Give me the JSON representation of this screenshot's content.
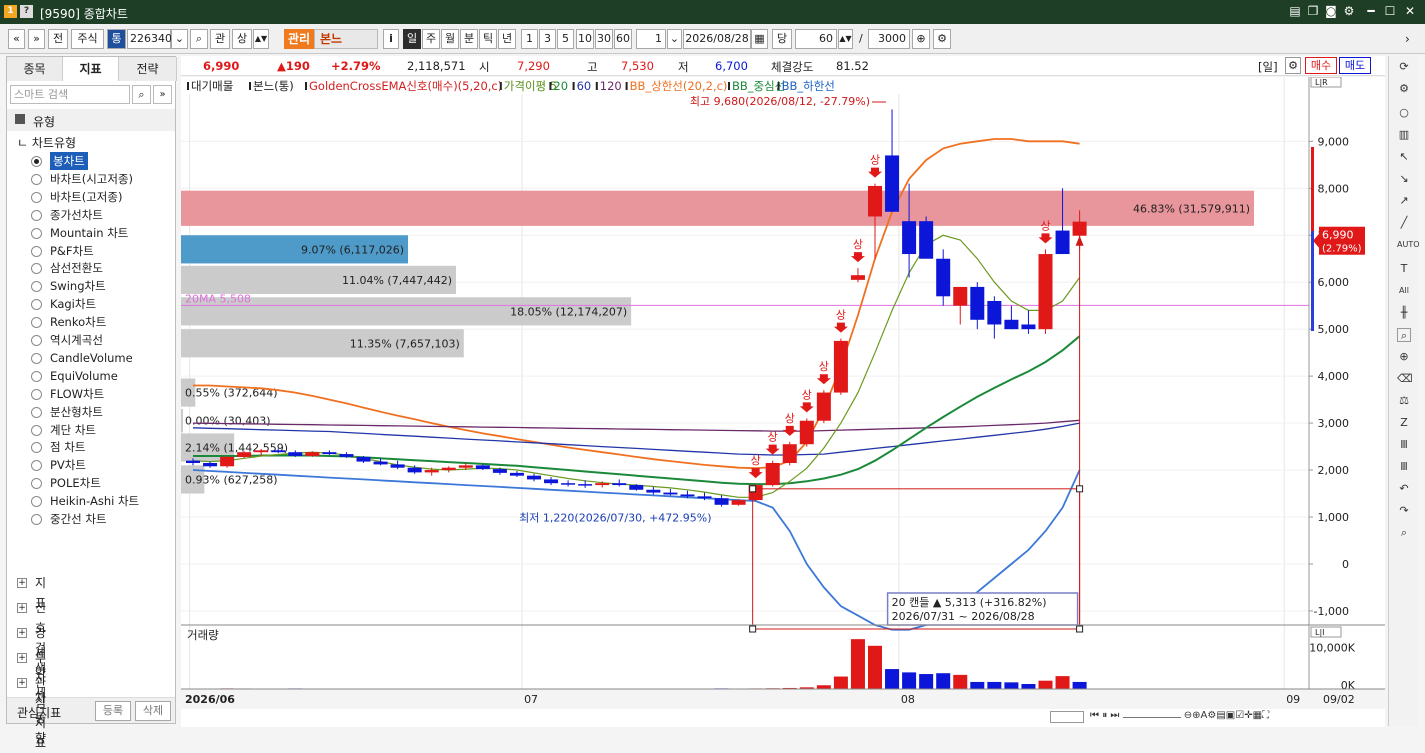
{
  "window": {
    "title": "[9590] 종합차트"
  },
  "toolbar": {
    "btn_prev": "«",
    "btn_down": "»",
    "btn_jeon": "전",
    "market": "주식",
    "market_badge": "통",
    "code": "226340",
    "btn_gwan": "관",
    "btn_sang": "상",
    "gwanli_label": "관리",
    "stock_name": "본느",
    "info": "i",
    "periods": [
      "일",
      "주",
      "월",
      "분",
      "틱",
      "년"
    ],
    "selected_period": "일",
    "intervals": [
      "1",
      "3",
      "5",
      "10",
      "30",
      "60"
    ],
    "count_value": "1",
    "date": "2026/08/28",
    "dang": "당",
    "display_count": "60",
    "slash": "/",
    "total_count": "3000"
  },
  "left_panel": {
    "tabs": [
      "종목",
      "지표",
      "전략"
    ],
    "selected_tab": "지표",
    "search_placeholder": "스마트 검색",
    "group_title": "유형",
    "subgroup_title": "차트유형",
    "chart_types": [
      "봉차트",
      "바차트(시고저종)",
      "바차트(고저종)",
      "종가선차트",
      "Mountain 차트",
      "P&F차트",
      "삼선전환도",
      "Swing차트",
      "Kagi차트",
      "Renko차트",
      "역시계곡선",
      "CandleVolume",
      "EquiVolume",
      "FLOW차트",
      "분산형차트",
      "계단 차트",
      "점 차트",
      "PV차트",
      "POLE차트",
      "Heikin-Ashi 차트",
      "중간선 차트"
    ],
    "selected_chart_type": "봉차트",
    "sections": [
      "지표",
      "신호검색",
      "강세약세",
      "투자자동향",
      "관심지표"
    ],
    "bottom_label": "관심지표",
    "btn_register": "등록",
    "btn_delete": "삭제"
  },
  "quote": {
    "price": "6,990",
    "change": "▲190",
    "change_pct": "+2.79%",
    "volume": "2,118,571",
    "open_label": "시",
    "open": "7,290",
    "high_label": "고",
    "high": "7,530",
    "low_label": "저",
    "low": "6,700",
    "strength_label": "체결강도",
    "strength": "81.52",
    "period_tag": "[일]",
    "buy_btn": "매수",
    "sell_btn": "매도"
  },
  "chart_data": {
    "type": "candlestick",
    "legend": [
      {
        "text": "대기매물",
        "color": "#222222"
      },
      {
        "text": "본느(통)",
        "color": "#222222"
      },
      {
        "text": "GoldenCrossEMA신호(매수)(5,20,c)",
        "color": "#d21f1f"
      },
      {
        "text": "가격이평 5",
        "color": "#5b8f1f"
      },
      {
        "text": "20",
        "color": "#1a8a3a"
      },
      {
        "text": "60",
        "color": "#2236a8"
      },
      {
        "text": "120",
        "color": "#6a2a6a"
      },
      {
        "text": "BB_상한선(20,2,c)",
        "color": "#f07020"
      },
      {
        "text": "BB_중심선",
        "color": "#1a8a3a"
      },
      {
        "text": "BB_하한선",
        "color": "#1c62c8"
      }
    ],
    "y_ticks": [
      "9,000",
      "8,000",
      "7,000",
      "6,000",
      "5,000",
      "4,000",
      "3,000",
      "2,000",
      "1,000",
      "0",
      "-1,000"
    ],
    "y_tick_values": [
      9000,
      8000,
      7000,
      6000,
      5000,
      4000,
      3000,
      2000,
      1000,
      0,
      -1000
    ],
    "ylim": [
      -1300,
      10200
    ],
    "x_labels": [
      "2026/06",
      "07",
      "08",
      "09",
      "09/02"
    ],
    "candles": [
      [
        2200,
        2250,
        2100,
        2150
      ],
      [
        2150,
        2180,
        2050,
        2080
      ],
      [
        2080,
        2300,
        2050,
        2280
      ],
      [
        2280,
        2400,
        2250,
        2380
      ],
      [
        2380,
        2450,
        2300,
        2420
      ],
      [
        2420,
        2460,
        2360,
        2380
      ],
      [
        2380,
        2420,
        2280,
        2300
      ],
      [
        2300,
        2400,
        2280,
        2380
      ],
      [
        2380,
        2420,
        2320,
        2340
      ],
      [
        2340,
        2380,
        2260,
        2280
      ],
      [
        2280,
        2300,
        2150,
        2180
      ],
      [
        2180,
        2250,
        2100,
        2120
      ],
      [
        2120,
        2200,
        2020,
        2050
      ],
      [
        2050,
        2100,
        1920,
        1950
      ],
      [
        1950,
        2050,
        1880,
        2000
      ],
      [
        2000,
        2080,
        1950,
        2050
      ],
      [
        2050,
        2150,
        2000,
        2100
      ],
      [
        2100,
        2120,
        2000,
        2020
      ],
      [
        2020,
        2050,
        1900,
        1940
      ],
      [
        1940,
        1980,
        1850,
        1880
      ],
      [
        1880,
        1920,
        1760,
        1800
      ],
      [
        1800,
        1850,
        1680,
        1720
      ],
      [
        1720,
        1780,
        1650,
        1700
      ],
      [
        1700,
        1780,
        1620,
        1680
      ],
      [
        1680,
        1760,
        1630,
        1720
      ],
      [
        1720,
        1800,
        1650,
        1680
      ],
      [
        1680,
        1700,
        1560,
        1580
      ],
      [
        1580,
        1640,
        1480,
        1520
      ],
      [
        1520,
        1600,
        1460,
        1480
      ],
      [
        1480,
        1560,
        1400,
        1440
      ],
      [
        1440,
        1520,
        1360,
        1400
      ],
      [
        1400,
        1460,
        1220,
        1260
      ],
      [
        1260,
        1380,
        1240,
        1360
      ],
      [
        1360,
        1700,
        1340,
        1680
      ],
      [
        1680,
        2200,
        1650,
        2150
      ],
      [
        2150,
        2600,
        2100,
        2550
      ],
      [
        2550,
        3100,
        2500,
        3050
      ],
      [
        3050,
        3700,
        3000,
        3650
      ],
      [
        3650,
        4800,
        3600,
        4750
      ],
      [
        6050,
        6300,
        6000,
        6150
      ],
      [
        7400,
        8100,
        6500,
        8050
      ],
      [
        8700,
        9680,
        7500,
        7500
      ],
      [
        7300,
        8100,
        6100,
        6600
      ],
      [
        7300,
        7400,
        6800,
        6500
      ],
      [
        6500,
        6700,
        5500,
        5700
      ],
      [
        5500,
        5800,
        5100,
        5900
      ],
      [
        5900,
        6000,
        5000,
        5200
      ],
      [
        5600,
        5700,
        4800,
        5100
      ],
      [
        5200,
        5500,
        5000,
        5000
      ],
      [
        5100,
        5400,
        4900,
        5000
      ],
      [
        5000,
        6700,
        4900,
        6600
      ],
      [
        7100,
        8000,
        6600,
        6600
      ],
      [
        6990,
        7530,
        6700,
        7290
      ]
    ],
    "candle_count": 53,
    "ma5_values": [
      2200,
      2180,
      2200,
      2250,
      2300,
      2330,
      2360,
      2380,
      2360,
      2320,
      2250,
      2180,
      2110,
      2060,
      2020,
      2000,
      2020,
      2040,
      2030,
      2000,
      1940,
      1880,
      1820,
      1770,
      1730,
      1700,
      1680,
      1650,
      1620,
      1580,
      1530,
      1470,
      1420,
      1420,
      1520,
      1760,
      2040,
      2470,
      3000,
      3650,
      4500,
      5400,
      6200,
      6800,
      7000,
      6900,
      6500,
      6000,
      5600,
      5400,
      5400,
      5600,
      6100
    ],
    "ma20_values": [
      2300,
      2300,
      2300,
      2300,
      2310,
      2310,
      2310,
      2310,
      2300,
      2290,
      2270,
      2250,
      2230,
      2210,
      2190,
      2170,
      2150,
      2130,
      2110,
      2090,
      2060,
      2030,
      2000,
      1970,
      1940,
      1910,
      1880,
      1850,
      1820,
      1790,
      1760,
      1730,
      1710,
      1700,
      1700,
      1720,
      1760,
      1820,
      1900,
      2020,
      2200,
      2420,
      2660,
      2900,
      3130,
      3350,
      3560,
      3750,
      3930,
      4100,
      4300,
      4550,
      4850
    ],
    "ma60_values": [
      2900,
      2890,
      2880,
      2870,
      2860,
      2850,
      2840,
      2830,
      2820,
      2800,
      2780,
      2760,
      2740,
      2720,
      2700,
      2680,
      2660,
      2640,
      2620,
      2600,
      2580,
      2560,
      2540,
      2520,
      2500,
      2480,
      2460,
      2440,
      2420,
      2400,
      2380,
      2360,
      2340,
      2330,
      2320,
      2320,
      2330,
      2340,
      2380,
      2420,
      2460,
      2500,
      2540,
      2580,
      2620,
      2660,
      2700,
      2740,
      2780,
      2820,
      2870,
      2930,
      3000
    ],
    "ma120_values": [
      3000,
      2995,
      2990,
      2985,
      2980,
      2975,
      2970,
      2965,
      2960,
      2955,
      2950,
      2945,
      2940,
      2935,
      2930,
      2925,
      2920,
      2915,
      2910,
      2905,
      2900,
      2895,
      2890,
      2885,
      2880,
      2875,
      2870,
      2865,
      2860,
      2855,
      2850,
      2845,
      2840,
      2835,
      2830,
      2830,
      2830,
      2840,
      2850,
      2860,
      2870,
      2880,
      2890,
      2900,
      2910,
      2920,
      2935,
      2950,
      2965,
      2980,
      3000,
      3030,
      3060
    ],
    "bb_upper_values": [
      3800,
      3800,
      3780,
      3760,
      3740,
      3700,
      3650,
      3580,
      3500,
      3420,
      3330,
      3240,
      3160,
      3080,
      3000,
      2920,
      2850,
      2780,
      2720,
      2660,
      2600,
      2540,
      2480,
      2430,
      2380,
      2330,
      2280,
      2230,
      2190,
      2150,
      2110,
      2080,
      2050,
      2040,
      2060,
      2200,
      2600,
      3300,
      4200,
      5300,
      6500,
      7500,
      8200,
      8600,
      8850,
      8950,
      9000,
      9050,
      9050,
      9000,
      9000,
      9000,
      8950
    ],
    "bb_lower_values": [
      2000,
      1980,
      1960,
      1940,
      1920,
      1900,
      1880,
      1860,
      1840,
      1820,
      1800,
      1780,
      1760,
      1740,
      1720,
      1700,
      1680,
      1660,
      1640,
      1620,
      1600,
      1580,
      1560,
      1540,
      1520,
      1500,
      1480,
      1460,
      1440,
      1420,
      1400,
      1380,
      1360,
      1340,
      1200,
      700,
      0,
      -500,
      -900,
      -1100,
      -1300,
      -1400,
      -1400,
      -1300,
      -1200,
      -900,
      -600,
      -300,
      0,
      300,
      700,
      1200,
      2000
    ],
    "buy_signals": [
      33,
      34,
      35,
      36,
      37,
      38,
      39,
      40,
      50
    ],
    "buy_signal_label": "상",
    "supply_zones": [
      {
        "label": "46.83% (31,579,911)",
        "from": 7200,
        "to": 7950,
        "pct": 0.9,
        "highlight": true
      },
      {
        "label": "9.07% (6,117,026)",
        "from": 6400,
        "to": 7000,
        "pct": 0.175
      },
      {
        "label": "11.04% (7,447,442)",
        "from": 5750,
        "to": 6350,
        "pct": 0.212
      },
      {
        "label": "18.05% (12,174,207)",
        "from": 5080,
        "to": 5680,
        "pct": 0.347
      },
      {
        "label": "11.35% (7,657,103)",
        "from": 4400,
        "to": 5000,
        "pct": 0.218
      },
      {
        "label": "0.55% (372,644)",
        "from": 3350,
        "to": 3950,
        "pct": 0.011
      },
      {
        "label": "0.00% (30,403)",
        "from": 2800,
        "to": 3300,
        "pct": 0.001
      },
      {
        "label": "2.14% (1,442,559)",
        "from": 2180,
        "to": 2780,
        "pct": 0.041
      },
      {
        "label": "0.93% (627,258)",
        "from": 1500,
        "to": 2100,
        "pct": 0.018
      }
    ],
    "ma20_line_label": "20MA 5,508",
    "ma20_line_value": 5508,
    "high_annotation": "최고 9,680(2026/08/12, -27.79%)",
    "low_annotation": "최저 1,220(2026/07/30, +472.95%)",
    "price_tag": "6,990",
    "price_tag_pct": "(2.79%)",
    "range_box": {
      "line1": "20 캔들  ▲ 5,313 (+316.82%)",
      "line2": "2026/07/31 ~ 2026/08/28",
      "from_index": 33,
      "to_index": 52
    },
    "volume_title": "거래량",
    "volume_ticks": [
      "10,000K",
      "0K"
    ],
    "volume_values": [
      120,
      100,
      150,
      130,
      110,
      100,
      140,
      120,
      100,
      110,
      90,
      100,
      120,
      110,
      90,
      80,
      100,
      110,
      120,
      90,
      100,
      80,
      110,
      90,
      100,
      80,
      90,
      70,
      80,
      60,
      80,
      150,
      100,
      140,
      180,
      250,
      400,
      900,
      3000,
      12000,
      10400,
      4800,
      4000,
      3600,
      3800,
      3400,
      1700,
      1700,
      1600,
      1200,
      2000,
      3100,
      1700
    ],
    "volume_up": [
      0,
      0,
      1,
      1,
      1,
      0,
      0,
      1,
      0,
      0,
      0,
      0,
      0,
      0,
      1,
      1,
      1,
      0,
      0,
      0,
      0,
      0,
      0,
      0,
      1,
      0,
      0,
      0,
      0,
      0,
      0,
      0,
      1,
      1,
      1,
      1,
      1,
      1,
      1,
      1,
      1,
      0,
      0,
      0,
      0,
      1,
      0,
      0,
      0,
      0,
      1,
      1,
      0
    ],
    "volume_max": 13000,
    "scale_tag": "L|R",
    "vol_scale_tag": "L|I"
  },
  "colors": {
    "up": "#e01818",
    "down": "#0b16d8",
    "accent": "#1f4e9c"
  }
}
